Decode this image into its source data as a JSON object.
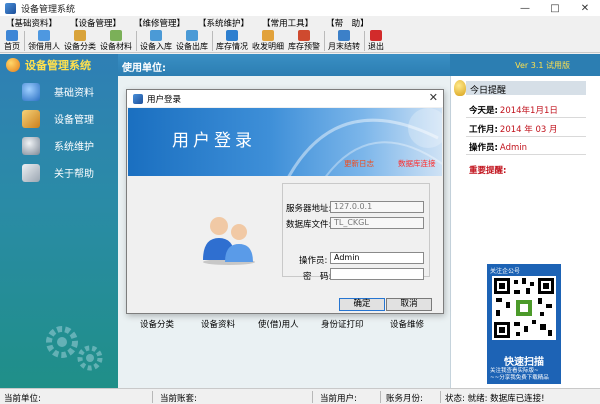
{
  "window": {
    "title": "设备管理系统",
    "controls": [
      "—",
      "□",
      "✕"
    ]
  },
  "menu": [
    "【基础资料】",
    "【设备管理】",
    "【维修管理】",
    "【系统维护】",
    "【常用工具】",
    "【帮　助】"
  ],
  "toolbar": [
    {
      "label": "首页",
      "icon": "home-icon",
      "color": "#3d86d6"
    },
    {
      "label": "领借用人",
      "icon": "user-icon",
      "color": "#4e98e0"
    },
    {
      "label": "设备分类",
      "icon": "category-icon",
      "color": "#d9a33a"
    },
    {
      "label": "设备材料",
      "icon": "material-icon",
      "color": "#7bb058"
    },
    {
      "label": "设备入库",
      "icon": "inbound-icon",
      "color": "#4b9ad6"
    },
    {
      "label": "设备出库",
      "icon": "outbound-icon",
      "color": "#4b9ad6"
    },
    {
      "label": "库存情况",
      "icon": "stock-icon",
      "color": "#2e7fcf"
    },
    {
      "label": "收发明细",
      "icon": "detail-icon",
      "color": "#e2a23b"
    },
    {
      "label": "库存预警",
      "icon": "warning-icon",
      "color": "#cf4a2f"
    },
    {
      "label": "月末结转",
      "icon": "month-end-icon",
      "color": "#3c80c8"
    },
    {
      "label": "退出",
      "icon": "exit-icon",
      "color": "#d22b2b"
    }
  ],
  "sidebar": {
    "title": "设备管理系统",
    "items": [
      {
        "label": "基础资料",
        "icon": "base-data-icon",
        "color": "#3a86d0"
      },
      {
        "label": "设备管理",
        "icon": "device-icon",
        "color": "#e0a03a"
      },
      {
        "label": "系统维护",
        "icon": "maintenance-icon",
        "color": "#9aa4b0"
      },
      {
        "label": "关于帮助",
        "icon": "help-icon",
        "color": "#d4d9de"
      }
    ]
  },
  "content": {
    "header_label": "使用单位:",
    "version": "Ver 3.1 试用版",
    "bottom_links": [
      "设备分类",
      "设备资料",
      "使(借)用人",
      "身份证打印",
      "设备维修"
    ]
  },
  "right_panel": {
    "title": "今日提醒",
    "today_key": "今天是:",
    "today_value": "2014年1月1日",
    "month_key": "工作月:",
    "month_value": "2014 年 03 月",
    "operator_key": "操作员:",
    "operator_value": "Admin",
    "important_key": "重要提醒:",
    "qr": {
      "top_text": "关注企公号",
      "scan_text": "快速扫描",
      "sub_line1": "关注我查看实际版~",
      "sub_line2": "~~分享我免费下载精品"
    }
  },
  "statusbar": {
    "unit": "当前单位:",
    "account": "当前账套:",
    "user": "当前用户:",
    "month": "账务月份:",
    "status": "状态: 就绪: 数据库已连接!"
  },
  "login_dialog": {
    "title": "用户登录",
    "close": "✕",
    "banner_title": "用户登录",
    "banner_link1": "更新日志",
    "banner_link2": "数据库连接",
    "server_label": "服务器地址:",
    "server_value": "127.0.0.1",
    "db_label": "数据库文件:",
    "db_value": "TL_CKGL",
    "operator_label": "操作员:",
    "operator_value": "Admin",
    "password_label": "密　码:",
    "password_value": "",
    "ok_label": "确定",
    "cancel_label": "取消"
  }
}
